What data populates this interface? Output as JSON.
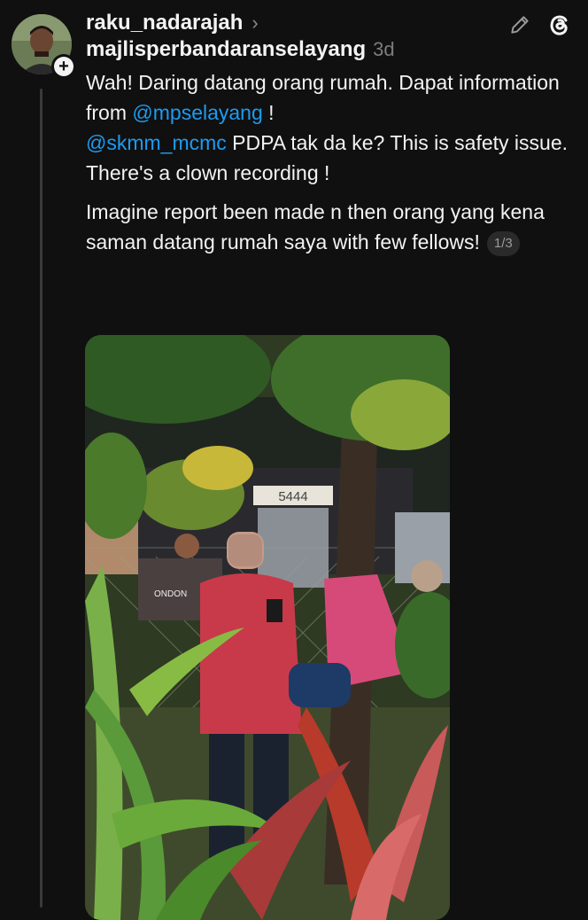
{
  "post": {
    "username": "raku_nadarajah",
    "reply_to": "majlisperbandaranselayang",
    "time": "3d",
    "line1_a": "Wah! Daring datang orang rumah. Dapat information from ",
    "mention1": "@mpselayang",
    "line1_b": " !",
    "mention2": "@skmm_mcmc",
    "line2_b": " PDPA tak da ke? This is safety issue.",
    "line3": "There's a clown recording !",
    "line4": "Imagine report been made n then orang yang kena saman datang rumah saya with few fellows!",
    "page_indicator": "1/3"
  },
  "media": {
    "sign_text": "5444",
    "shirt_text": "ONDON"
  },
  "icons": {
    "edit": "pencil-icon",
    "threads": "threads-logo-icon",
    "follow": "plus-icon",
    "chevron": "chevron-right-icon"
  },
  "colors": {
    "background": "#101010",
    "mention": "#1d9bf0",
    "muted": "#7d7d7d"
  }
}
